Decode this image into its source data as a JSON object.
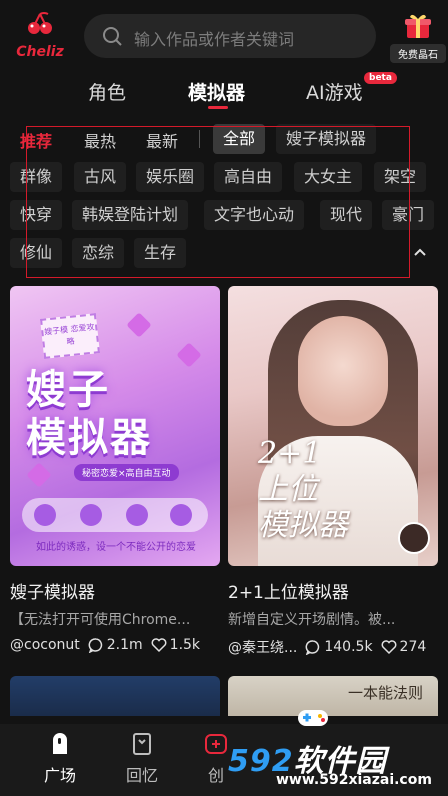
{
  "header": {
    "brand": "Cheliz",
    "search_placeholder": "输入作品或作者关键词",
    "gift_label": "免费晶石"
  },
  "main_tabs": [
    {
      "label": "角色",
      "active": false
    },
    {
      "label": "模拟器",
      "active": true
    },
    {
      "label": "AI游戏",
      "active": false,
      "badge": "beta"
    }
  ],
  "filters": {
    "sort": [
      {
        "label": "推荐",
        "active": true
      },
      {
        "label": "最热",
        "active": false
      },
      {
        "label": "最新",
        "active": false
      }
    ],
    "tags": [
      {
        "label": "全部",
        "active": true
      },
      {
        "label": "嫂子模拟器",
        "active": false
      },
      {
        "label": "群像",
        "active": false
      },
      {
        "label": "古风",
        "active": false
      },
      {
        "label": "娱乐圈",
        "active": false
      },
      {
        "label": "高自由",
        "active": false
      },
      {
        "label": "大女主",
        "active": false
      },
      {
        "label": "架空",
        "active": false
      },
      {
        "label": "快穿",
        "active": false
      },
      {
        "label": "韩娱登陆计划",
        "active": false
      },
      {
        "label": "文字也心动",
        "active": false
      },
      {
        "label": "现代",
        "active": false
      },
      {
        "label": "豪门",
        "active": false
      },
      {
        "label": "修仙",
        "active": false
      },
      {
        "label": "恋综",
        "active": false
      },
      {
        "label": "生存",
        "active": false
      }
    ]
  },
  "cards": [
    {
      "title": "嫂子模拟器",
      "desc": "【无法打开可使用Chrome...",
      "author": "@coconut",
      "comments": "2.1m",
      "likes": "1.5k",
      "cover_title_line1": "嫂子",
      "cover_title_line2": "模拟器",
      "cover_banner": "秘密恋爱×高自由互动",
      "cover_sticker": "嫂子模 恋爱攻略",
      "cover_foot": "如此的诱惑，设一个不能公开的恋爱"
    },
    {
      "title": "2+1上位模拟器",
      "desc": "新增自定义开场剧情。被...",
      "author": "@秦王绕...",
      "comments": "140.5k",
      "likes": "274",
      "cover_title_line1": "2+1",
      "cover_title_line2": "上位",
      "cover_title_line3": "模拟器"
    }
  ],
  "peek_cards": [
    {
      "cover_text": ""
    },
    {
      "cover_text": "一本能法则"
    }
  ],
  "bottom_nav": [
    {
      "label": "广场",
      "active": true
    },
    {
      "label": "回忆",
      "active": false
    },
    {
      "label": "创",
      "active": false
    }
  ],
  "watermark": {
    "num": "592",
    "name": "软件园",
    "url": "www.592xiazai.com"
  },
  "colors": {
    "accent": "#e8283c",
    "background": "#131313",
    "chip_bg": "#1f1f1f"
  }
}
